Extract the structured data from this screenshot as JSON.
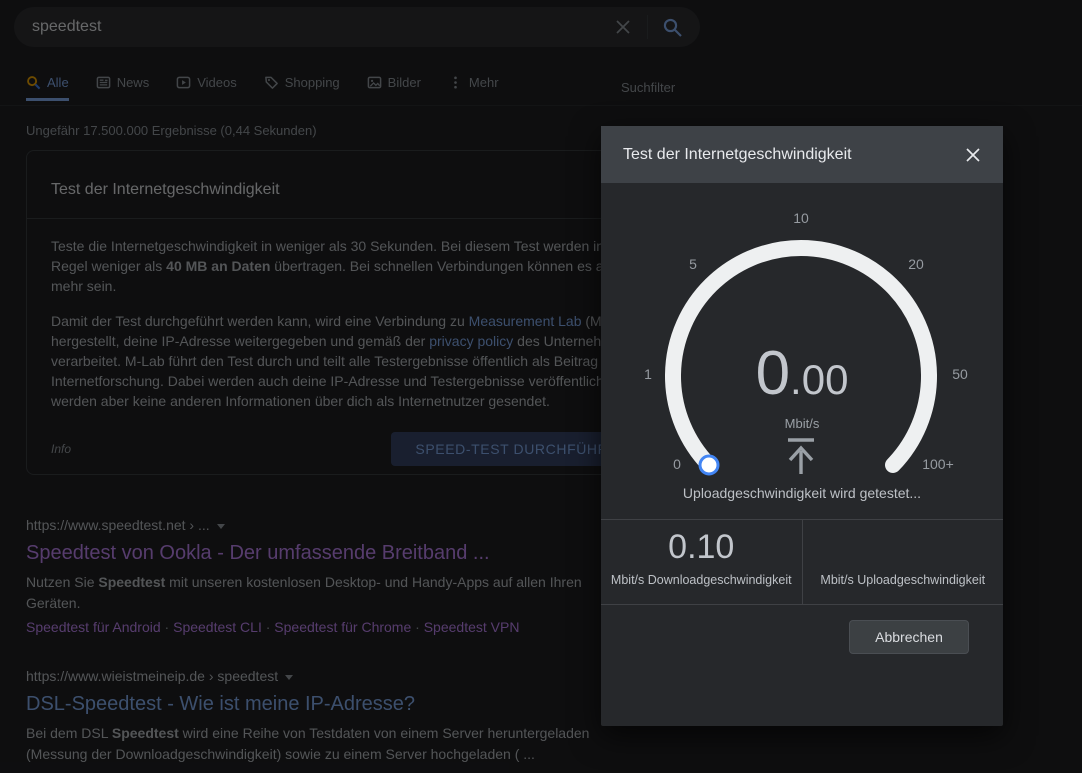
{
  "colors": {
    "accent_blue": "#8ab4f8",
    "visited_purple": "#c58af9",
    "knob_blue": "#4285f4",
    "gauge_arc": "#eef0f1",
    "dialog_header_bg": "#3e4247",
    "dialog_body_bg": "#26282b"
  },
  "search_bar": {
    "query": "speedtest"
  },
  "tabs": {
    "items": [
      {
        "label": "Alle"
      },
      {
        "label": "News"
      },
      {
        "label": "Videos"
      },
      {
        "label": "Shopping"
      },
      {
        "label": "Bilder"
      },
      {
        "label": "Mehr"
      }
    ],
    "filter_label": "Suchfilter"
  },
  "stats_line": "Ungefähr 17.500.000 Ergebnisse (0,44 Sekunden)",
  "answer_card": {
    "title": "Test der Internetgeschwindigkeit",
    "paragraph1_lines": [
      [
        {
          "t": "Teste die Internetgeschwindigkeit in weniger als 30 Sekunden. Bei diesem Test werden in der",
          "s": "p"
        }
      ],
      [
        {
          "t": "Regel weniger als ",
          "s": "p"
        },
        {
          "t": "40 MB an Daten",
          "s": "b"
        },
        {
          "t": " übertragen. Bei schnellen Verbindungen können es aber",
          "s": "p"
        }
      ],
      [
        {
          "t": "mehr sein.",
          "s": "p"
        }
      ]
    ],
    "paragraph2_lines": [
      [
        {
          "t": "Damit der Test durchgeführt werden kann, wird eine Verbindung zu ",
          "s": "p"
        },
        {
          "t": "Measurement Lab",
          "s": "link"
        },
        {
          "t": " (M-Lab)",
          "s": "p"
        }
      ],
      [
        {
          "t": "hergestellt, deine IP-Adresse weitergegeben und gemäß der ",
          "s": "p"
        },
        {
          "t": "privacy policy",
          "s": "link"
        },
        {
          "t": " des Unternehmens",
          "s": "p"
        }
      ],
      [
        {
          "t": "verarbeitet. M-Lab führt den Test durch und teilt alle Testergebnisse öffentlich als Beitrag zur",
          "s": "p"
        }
      ],
      [
        {
          "t": "Internetforschung. Dabei werden auch deine IP-Adresse und Testergebnisse veröffentlicht. Es",
          "s": "p"
        }
      ],
      [
        {
          "t": "werden aber keine anderen Informationen über dich als Internetnutzer gesendet.",
          "s": "p"
        }
      ]
    ],
    "info_label": "Info",
    "run_button_label": "SPEED-TEST DURCHFÜHREN"
  },
  "results": [
    {
      "breadcrumb": "https://www.speedtest.net › ...",
      "title": "Speedtest von Ookla - Der umfassende Breitband ...",
      "snippet": [
        {
          "t": "Nutzen Sie ",
          "s": "p"
        },
        {
          "t": "Speedtest",
          "s": "b"
        },
        {
          "t": " mit unseren kostenlosen Desktop- und Handy-Apps auf allen Ihren Geräten.",
          "s": "p"
        }
      ],
      "sitelinks": [
        {
          "t": "Speedtest für Android",
          "s": "sitelink"
        },
        {
          "t": " · ",
          "s": "sep"
        },
        {
          "t": "Speedtest CLI",
          "s": "sitelink"
        },
        {
          "t": " · ",
          "s": "sep"
        },
        {
          "t": "Speedtest für Chrome",
          "s": "sitelink"
        },
        {
          "t": " · ",
          "s": "sep"
        },
        {
          "t": "Speedtest VPN",
          "s": "sitelink"
        }
      ]
    },
    {
      "breadcrumb": "https://www.wieistmeineip.de › speedtest",
      "title": "DSL-Speedtest - Wie ist meine IP-Adresse?",
      "snippet": [
        {
          "t": "Bei dem DSL ",
          "s": "p"
        },
        {
          "t": "Speedtest",
          "s": "b"
        },
        {
          "t": " wird eine Reihe von Testdaten von einem Server heruntergeladen (Messung der Downloadgeschwindigkeit) sowie zu einem Server hochgeladen ( ...",
          "s": "p"
        }
      ],
      "sitelinks": []
    }
  ],
  "dialog": {
    "title": "Test der Internetgeschwindigkeit",
    "gauge": {
      "ticks": [
        "0",
        "1",
        "5",
        "10",
        "20",
        "50",
        "100+"
      ],
      "value_int": "0",
      "value_frac": ".00",
      "unit": "Mbit/s",
      "status": "Uploadgeschwindigkeit wird getestet..."
    },
    "result_cells": {
      "download_value": "0.10",
      "download_label": "Mbit/s Downloadgeschwindigkeit",
      "upload_label": "Mbit/s Uploadgeschwindigkeit"
    },
    "cancel_label": "Abbrechen"
  }
}
